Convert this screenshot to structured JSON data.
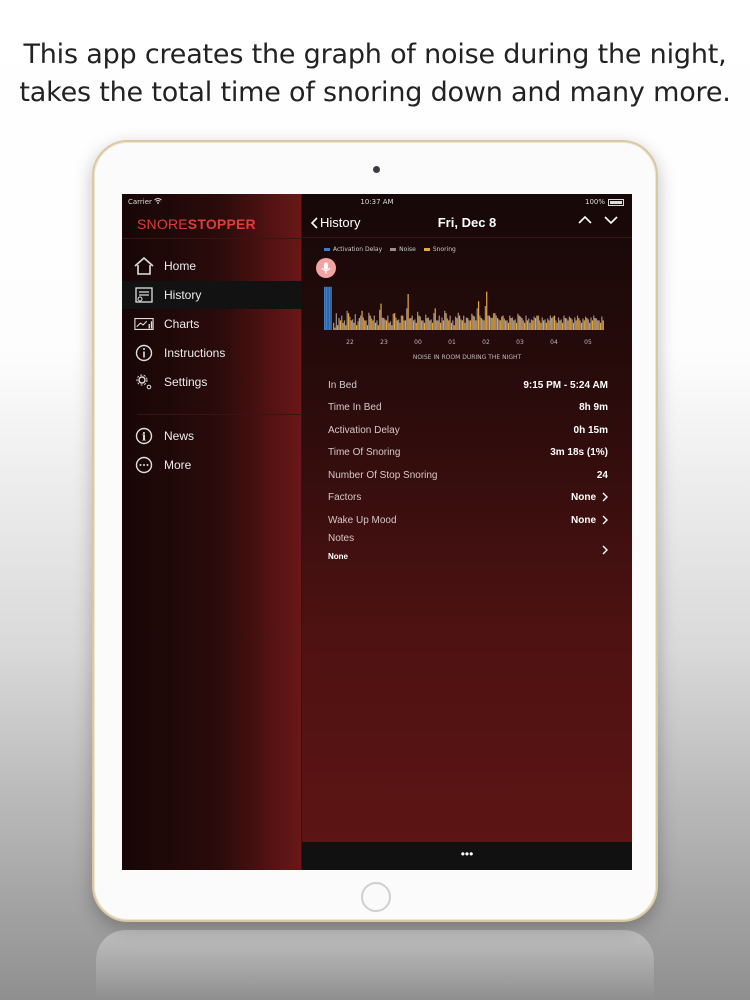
{
  "promo": {
    "line1": "This app creates the graph of noise  during the night,",
    "line2": "takes the total time of snoring down and many more."
  },
  "status": {
    "carrier": "Carrier",
    "time": "10:37 AM",
    "battery": "100%"
  },
  "brand": {
    "part1": "SNORE",
    "part2": "STOPPER",
    "color": "#e23b3b"
  },
  "sidebar": {
    "items": [
      {
        "label": "Home",
        "icon": "home-icon"
      },
      {
        "label": "History",
        "icon": "history-icon",
        "active": true
      },
      {
        "label": "Charts",
        "icon": "charts-icon"
      },
      {
        "label": "Instructions",
        "icon": "info-icon"
      },
      {
        "label": "Settings",
        "icon": "gear-icon"
      },
      {
        "label": "News",
        "icon": "news-icon"
      },
      {
        "label": "More",
        "icon": "more-icon"
      }
    ]
  },
  "header": {
    "back_label": "History",
    "title": "Fri, Dec 8"
  },
  "chart_data": {
    "type": "bar",
    "title": "",
    "xlabel": "NOISE IN ROOM DURING THE NIGHT",
    "ylabel": "",
    "tick_labels": [
      "22",
      "23",
      "00",
      "01",
      "02",
      "03",
      "04",
      "05"
    ],
    "legend": [
      {
        "name": "Activation Delay",
        "color": "#3d7ec9"
      },
      {
        "name": "Noise",
        "color": "#9a8f8f"
      },
      {
        "name": "Snoring",
        "color": "#e6a73a"
      }
    ],
    "series": [
      {
        "name": "Activation Delay",
        "values": [
          0.9,
          0.9,
          0.9,
          0.9,
          0.9
        ]
      },
      {
        "name": "Noise",
        "values": [
          0.15,
          0.35,
          0.25,
          0.3,
          0.2,
          0.4,
          0.28,
          0.22,
          0.33,
          0.18,
          0.3,
          0.26,
          0.2,
          0.36,
          0.24,
          0.3,
          0.2,
          0.42,
          0.26,
          0.22,
          0.3,
          0.18,
          0.34,
          0.26,
          0.22,
          0.3,
          0.2,
          0.45,
          0.24,
          0.3,
          0.22,
          0.38,
          0.28,
          0.2,
          0.32,
          0.26,
          0.22,
          0.35,
          0.2,
          0.3,
          0.26,
          0.4,
          0.24,
          0.3,
          0.2,
          0.28,
          0.36,
          0.22,
          0.3,
          0.26,
          0.2,
          0.34,
          0.28,
          0.45,
          0.3,
          0.22,
          0.5,
          0.3,
          0.26,
          0.35,
          0.3,
          0.22,
          0.28,
          0.24,
          0.2,
          0.3,
          0.26,
          0.22,
          0.34,
          0.28,
          0.2,
          0.3,
          0.24,
          0.22,
          0.28,
          0.3,
          0.2,
          0.26,
          0.22,
          0.24,
          0.3,
          0.28,
          0.2,
          0.26,
          0.22,
          0.3,
          0.24,
          0.28,
          0.22,
          0.26,
          0.3,
          0.2,
          0.24,
          0.28,
          0.22,
          0.26,
          0.3,
          0.24,
          0.2,
          0.28
        ]
      },
      {
        "name": "Snoring",
        "values": [
          0.05,
          0.1,
          0.2,
          0.15,
          0.1,
          0.35,
          0.2,
          0.15,
          0.1,
          0.25,
          0.4,
          0.2,
          0.1,
          0.3,
          0.2,
          0.15,
          0.1,
          0.55,
          0.25,
          0.2,
          0.15,
          0.1,
          0.35,
          0.2,
          0.15,
          0.3,
          0.2,
          0.75,
          0.25,
          0.2,
          0.15,
          0.3,
          0.2,
          0.15,
          0.25,
          0.2,
          0.15,
          0.45,
          0.2,
          0.15,
          0.2,
          0.35,
          0.2,
          0.15,
          0.1,
          0.25,
          0.3,
          0.2,
          0.15,
          0.25,
          0.2,
          0.3,
          0.2,
          0.6,
          0.25,
          0.2,
          0.8,
          0.3,
          0.25,
          0.35,
          0.25,
          0.2,
          0.3,
          0.2,
          0.15,
          0.25,
          0.2,
          0.15,
          0.3,
          0.25,
          0.15,
          0.2,
          0.15,
          0.2,
          0.25,
          0.3,
          0.15,
          0.2,
          0.15,
          0.2,
          0.25,
          0.3,
          0.15,
          0.2,
          0.15,
          0.25,
          0.2,
          0.25,
          0.15,
          0.2,
          0.25,
          0.15,
          0.2,
          0.25,
          0.15,
          0.2,
          0.25,
          0.2,
          0.15,
          0.2
        ]
      }
    ],
    "ylim": [
      0,
      1
    ]
  },
  "details": {
    "rows": [
      {
        "label": "In Bed",
        "value": "9:15 PM - 5:24 AM"
      },
      {
        "label": "Time In Bed",
        "value": "8h 9m"
      },
      {
        "label": "Activation Delay",
        "value": "0h 15m"
      },
      {
        "label": "Time Of Snoring",
        "value": "3m 18s (1%)"
      },
      {
        "label": "Number Of Stop Snoring",
        "value": "24"
      },
      {
        "label": "Factors",
        "value": "None",
        "chevron": true
      },
      {
        "label": "Wake Up Mood",
        "value": "None",
        "chevron": true
      },
      {
        "label": "Notes",
        "value": "",
        "chevron": true
      }
    ],
    "notes_value": "None"
  },
  "bottom_bar": {
    "label": "•••"
  }
}
